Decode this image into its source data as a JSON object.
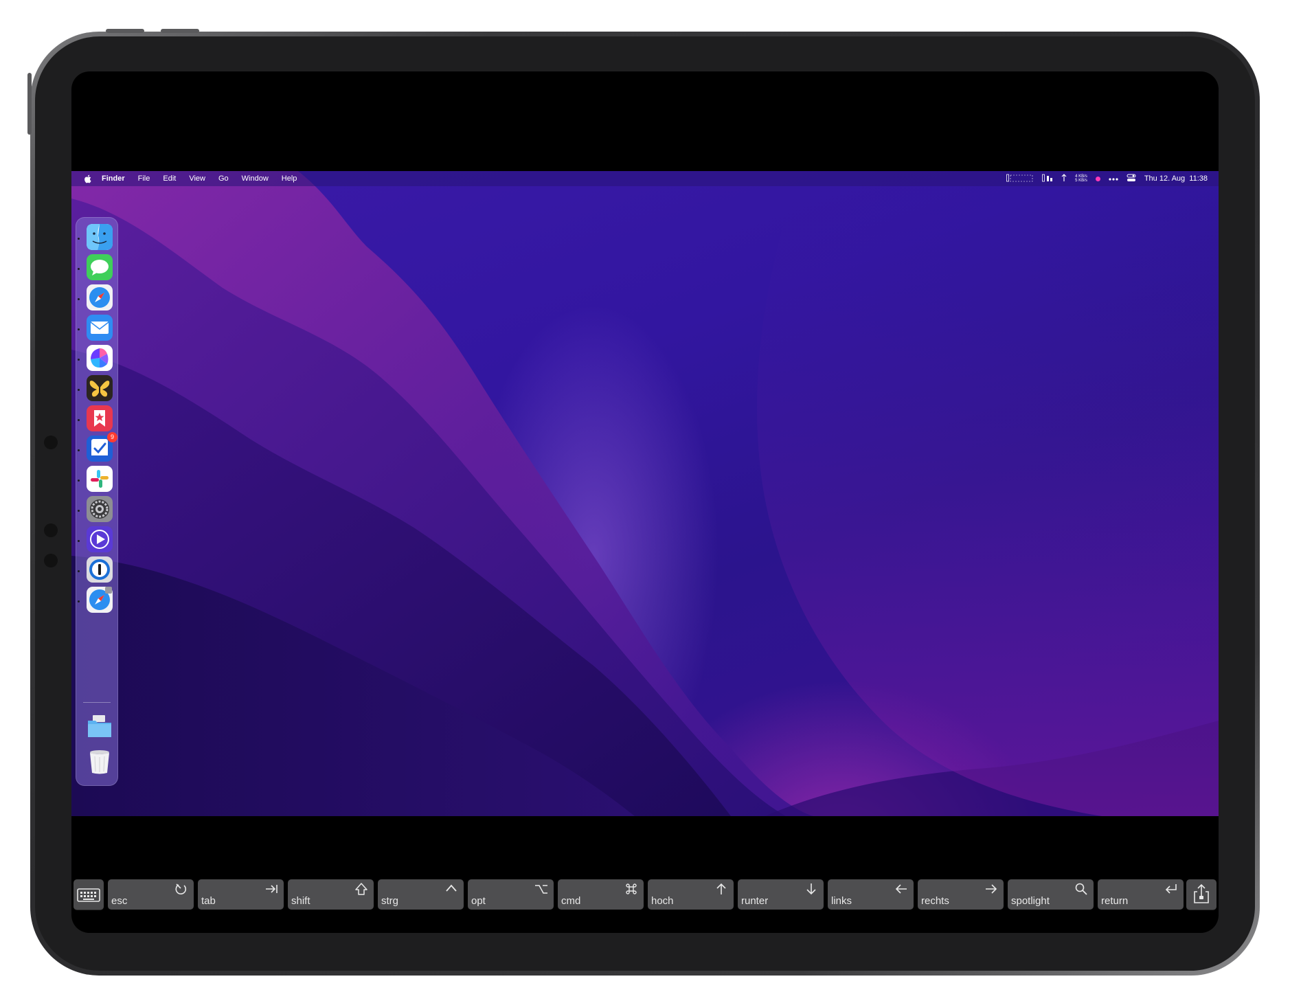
{
  "menubar": {
    "apple": "apple-icon",
    "app_name": "Finder",
    "menus": [
      "File",
      "Edit",
      "View",
      "Go",
      "Window",
      "Help"
    ],
    "net_up": "4 KB/s",
    "net_down": "5 KB/s",
    "date": "Thu 12. Aug",
    "time": "11:38"
  },
  "dock": {
    "items": [
      {
        "name": "Finder",
        "icon": "finder-icon"
      },
      {
        "name": "Messages",
        "icon": "messages-icon"
      },
      {
        "name": "Safari",
        "icon": "safari-icon"
      },
      {
        "name": "Mail",
        "icon": "mail-icon"
      },
      {
        "name": "Craft",
        "icon": "craft-icon"
      },
      {
        "name": "Tes",
        "icon": "butterfly-icon"
      },
      {
        "name": "GoodLinks",
        "icon": "goodlinks-icon"
      },
      {
        "name": "Tasks",
        "icon": "tasks-icon",
        "badge": "9"
      },
      {
        "name": "Slack",
        "icon": "slack-icon"
      },
      {
        "name": "System Preferences",
        "icon": "settings-icon"
      },
      {
        "name": "Infuse",
        "icon": "play-icon"
      },
      {
        "name": "1Password",
        "icon": "onepassword-icon"
      },
      {
        "name": "Safari Technology Preview",
        "icon": "safari-preview-icon"
      },
      {
        "name": "Downloads",
        "icon": "folder-icon"
      },
      {
        "name": "Trash",
        "icon": "trash-icon"
      }
    ]
  },
  "keys": [
    {
      "label": "esc",
      "icon": "esc-icon"
    },
    {
      "label": "tab",
      "icon": "tab-icon"
    },
    {
      "label": "shift",
      "icon": "shift-icon"
    },
    {
      "label": "strg",
      "icon": "control-icon"
    },
    {
      "label": "opt",
      "icon": "option-icon"
    },
    {
      "label": "cmd",
      "icon": "command-icon"
    },
    {
      "label": "hoch",
      "icon": "arrow-up-icon"
    },
    {
      "label": "runter",
      "icon": "arrow-down-icon"
    },
    {
      "label": "links",
      "icon": "arrow-left-icon"
    },
    {
      "label": "rechts",
      "icon": "arrow-right-icon"
    },
    {
      "label": "spotlight",
      "icon": "search-icon"
    },
    {
      "label": "return",
      "icon": "return-icon"
    }
  ],
  "colors": {
    "wallpaper_base": "#2b148d",
    "wallpaper_glow": "#d63abe",
    "key_background": "#4e4e50",
    "screen_background": "#000000"
  }
}
